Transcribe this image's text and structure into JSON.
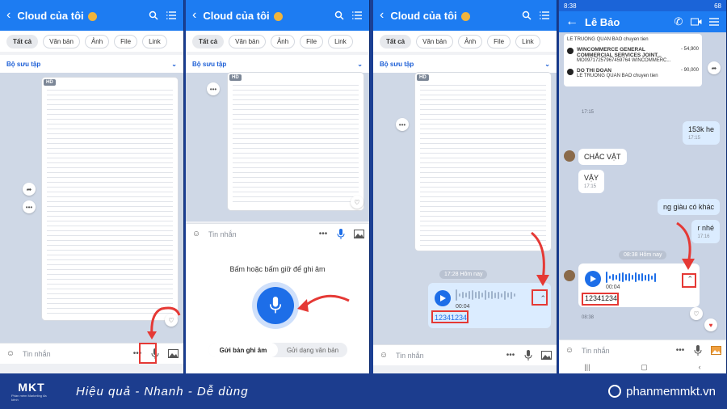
{
  "cloud": {
    "title": "Cloud của tôi",
    "filters": [
      "Tất cả",
      "Văn bản",
      "Ảnh",
      "File",
      "Link"
    ],
    "collection_label": "Bộ sưu tập",
    "hd_badge": "HD",
    "input_placeholder": "Tin nhắn",
    "more_label": "•••"
  },
  "recorder": {
    "hint": "Bấm hoặc bấm giữ để ghi âm",
    "mode_send_audio": "Gửi bản ghi âm",
    "mode_send_text": "Gửi dạng văn bản"
  },
  "voice_cloud": {
    "time_pill": "17:28 Hôm nay",
    "duration": "00:04",
    "transcript": "12341234"
  },
  "chat": {
    "status_time": "8:38",
    "battery": "68",
    "contact_name": "Lê Bảo",
    "transactions": [
      {
        "name": "LE TRUONG QUAN BAO chuyen tien",
        "amount": ""
      },
      {
        "name": "WINCOMMERCE GENERAL COMMERCIAL SERVICES JOINT...",
        "sub": "MO09717257967459764 WINCOMMERC...",
        "amount": "- 54,900"
      },
      {
        "name": "DO THI DOAN",
        "sub": "LE TRUONG QUAN BAO chuyen tien",
        "amount": "- 90,000"
      }
    ],
    "messages": [
      {
        "text": "17:15",
        "kind": "time"
      },
      {
        "text": "153k he",
        "time": "17:15",
        "dir": "out"
      },
      {
        "text": "CHẮC VẬT",
        "dir": "in"
      },
      {
        "text": "VẬY",
        "time": "17:15",
        "dir": "in"
      },
      {
        "text": "ng giàu có khác",
        "dir": "out"
      },
      {
        "text": "r nhé",
        "time": "17:16",
        "dir": "out"
      }
    ],
    "time_pill": "08:38 Hôm nay",
    "voice_duration": "00:04",
    "voice_transcript": "12341234",
    "voice_time": "08:38",
    "input_placeholder": "Tin nhắn"
  },
  "footer": {
    "brand": "MKT",
    "brand_sub": "Phần mềm Marketing đa kênh",
    "slogan": "Hiệu quả - Nhanh - Dễ dùng",
    "website": "phanmemmkt.vn"
  },
  "colors": {
    "primary": "#1d7cf2",
    "highlight": "#e53935",
    "footer_bg": "#1c3d8e"
  }
}
